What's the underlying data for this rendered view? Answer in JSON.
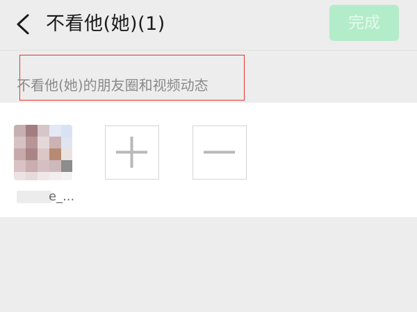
{
  "header": {
    "title": "不看他(她)(1)",
    "done_label": "完成",
    "back_icon": "chevron-left-icon",
    "done_color": "#b3ecc9"
  },
  "section": {
    "hint": "不看他(她)的朋友圈和视频动态",
    "highlight_color": "#e5332b"
  },
  "members": [
    {
      "name": "e_..."
    }
  ],
  "actions": {
    "add_icon": "plus-icon",
    "remove_icon": "minus-icon"
  }
}
